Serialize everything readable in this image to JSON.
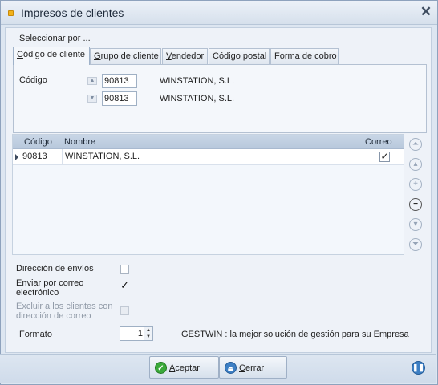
{
  "window": {
    "title": "Impresos de clientes",
    "close_icon": "close-icon"
  },
  "selection": {
    "group_label": "Seleccionar por ...",
    "tabs": [
      {
        "label": "Código de cliente",
        "accel": "C",
        "rest": "ódigo de cliente",
        "active": true
      },
      {
        "label": "Grupo de cliente",
        "accel": "G",
        "rest": "rupo de cliente",
        "active": false
      },
      {
        "label": "Vendedor",
        "accel": "V",
        "rest": "endedor",
        "active": false
      },
      {
        "label": "Código postal",
        "accel": "",
        "rest": "Código postal",
        "active": false
      },
      {
        "label": "Forma de cobro",
        "accel": "",
        "rest": "Forma de cobro",
        "active": false
      }
    ],
    "field_label": "Código",
    "from": {
      "code": "90813",
      "name": "WINSTATION, S.L."
    },
    "to": {
      "code": "90813",
      "name": "WINSTATION, S.L."
    }
  },
  "grid": {
    "columns": [
      "Código",
      "Nombre",
      "Correo"
    ],
    "rows": [
      {
        "code": "90813",
        "name": "WINSTATION, S.L.",
        "correo": true
      }
    ],
    "nav_icons": [
      "first-icon",
      "previous-icon",
      "add-icon",
      "remove-icon",
      "next-icon",
      "last-icon"
    ]
  },
  "options": {
    "direccion_envios": {
      "label": "Dirección de envíos",
      "checked": false
    },
    "enviar_correo": {
      "line1": "Enviar por correo",
      "line2": "electrónico",
      "checked": true
    },
    "excluir": {
      "line1": "Excluir a los clientes con",
      "line2": "dirección de correo",
      "checked": false,
      "disabled": true
    }
  },
  "format": {
    "label": "Formato",
    "value": "1"
  },
  "promo_text": "GESTWIN : la mejor solución de gestión para su Empresa",
  "buttons": {
    "accept": {
      "accel": "A",
      "rest": "ceptar"
    },
    "cancel": {
      "accel": "C",
      "rest": "errar"
    }
  },
  "colors": {
    "accent": "#3d7fc4",
    "ok": "#3aa93a",
    "header": "#c9d6e6"
  }
}
